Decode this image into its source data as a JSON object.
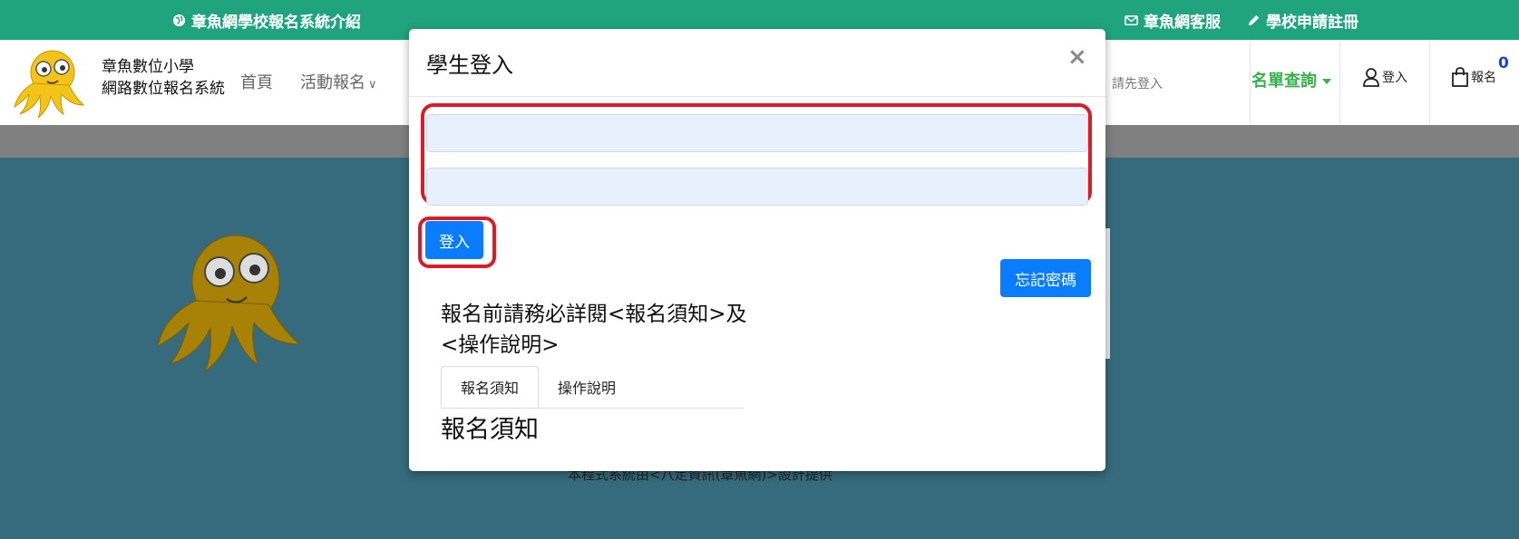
{
  "topbar": {
    "intro": "章魚網學校報名系統介紹",
    "service": "章魚網客服",
    "apply": "學校申請註冊"
  },
  "navbar": {
    "school_line1": "章魚數位小學",
    "school_line2": "網路數位報名系統",
    "home": "首頁",
    "activity": "活動報名",
    "hint": "請先登入",
    "query": "名單查詢",
    "login": "登入",
    "cart_label": "報名",
    "cart_count": "0"
  },
  "footer": {
    "text": "本程式系統由<八定資訊(章魚網)>設計提供"
  },
  "modal": {
    "title": "學生登入",
    "close": "×",
    "username_value": "",
    "password_value": "",
    "login_button": "登入",
    "forgot_button": "忘記密碼",
    "notice": "報名前請務必詳閱<報名須知>及<操作說明>",
    "tabs": [
      "報名須知",
      "操作說明"
    ],
    "section_heading": "報名須知"
  },
  "colors": {
    "topbar": "#1fa47e",
    "primary_button": "#0a7cff",
    "highlight": "#d91c28",
    "query_green": "#34b24a",
    "page_bg": "#356b7c"
  }
}
